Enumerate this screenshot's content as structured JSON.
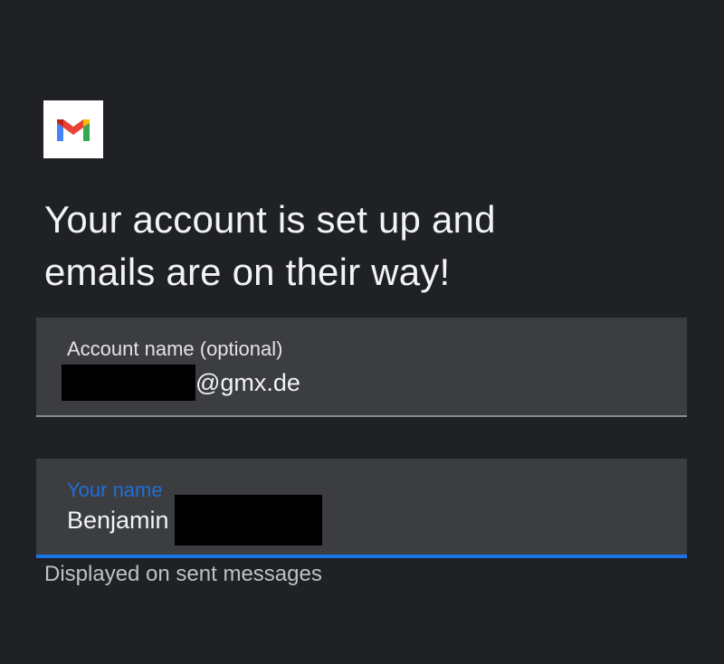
{
  "logo": {
    "icon": "gmail-logo-icon",
    "colors": {
      "red": "#EA4335",
      "blue": "#4285F4",
      "green": "#34A853",
      "yellow": "#FBBC04",
      "dark_red": "#C5221F"
    }
  },
  "headline": {
    "line1": "Your account is set up and",
    "line2": "emails are on their way!"
  },
  "account_field": {
    "label": "Account name (optional)",
    "value_suffix": "@gmx.de"
  },
  "name_field": {
    "label": "Your name",
    "value": "Benjamin",
    "helper": "Displayed on sent messages"
  },
  "theme": {
    "background": "#202124",
    "field_background": "#3c3d41",
    "accent": "#1a73e8"
  }
}
